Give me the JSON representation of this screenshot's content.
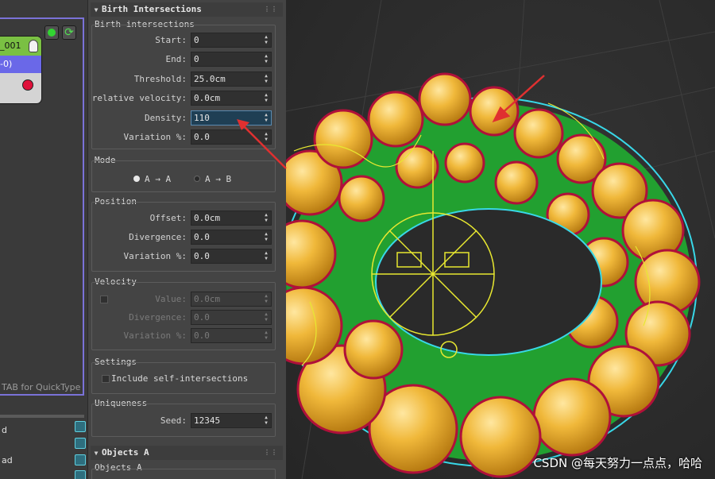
{
  "node_editor": {
    "node_title": "_001",
    "node_operator": "-0)",
    "quicktype_hint": "TAB for QuickType",
    "bottom_labels": [
      "d",
      "ad"
    ]
  },
  "birth_intersections": {
    "rollout_title": "Birth Intersections",
    "group_label": "Birth intersections",
    "start_label": "Start:",
    "start_value": "0",
    "end_label": "End:",
    "end_value": "0",
    "threshold_label": "Threshold:",
    "threshold_value": "25.0cm",
    "rel_velocity_label": "relative velocity:",
    "rel_velocity_value": "0.0cm",
    "density_label": "Density:",
    "density_value": "110",
    "variation_label": "Variation %:",
    "variation_value": "0.0"
  },
  "mode": {
    "group_label": "Mode",
    "option_aa": "A → A",
    "option_ab": "A → B",
    "selected": "A → A"
  },
  "position": {
    "group_label": "Position",
    "offset_label": "Offset:",
    "offset_value": "0.0cm",
    "divergence_label": "Divergence:",
    "divergence_value": "0.0",
    "variation_label": "Variation %:",
    "variation_value": "0.0"
  },
  "velocity": {
    "group_label": "Velocity",
    "value_label": "Value:",
    "value_value": "0.0cm",
    "divergence_label": "Divergence:",
    "divergence_value": "0.0",
    "variation_label": "Variation %:",
    "variation_value": "0.0",
    "enabled": false
  },
  "settings": {
    "group_label": "Settings",
    "self_intersections_label": "Include self-intersections",
    "self_intersections_checked": false
  },
  "uniqueness": {
    "group_label": "Uniqueness",
    "seed_label": "Seed:",
    "seed_value": "12345"
  },
  "objects_a": {
    "rollout_title": "Objects A",
    "group_label": "Objects A"
  },
  "viewport": {
    "watermark": "CSDN @每天努力一点点，哈哈",
    "colors": {
      "blob": "#e8b030",
      "mesh": "#22a030",
      "contour": "#b0103a",
      "outline": "#38d8e8",
      "helper": "#e8e830",
      "annotation_arrow": "#e03030"
    }
  },
  "icons": [
    "green-dot-icon",
    "refresh-icon",
    "bulb-icon",
    "output-port-icon",
    "operator-icon",
    "collapse-arrow-icon",
    "spinner-arrows-icon",
    "radio-icon",
    "checkbox-icon",
    "annotation-arrow-icon"
  ]
}
